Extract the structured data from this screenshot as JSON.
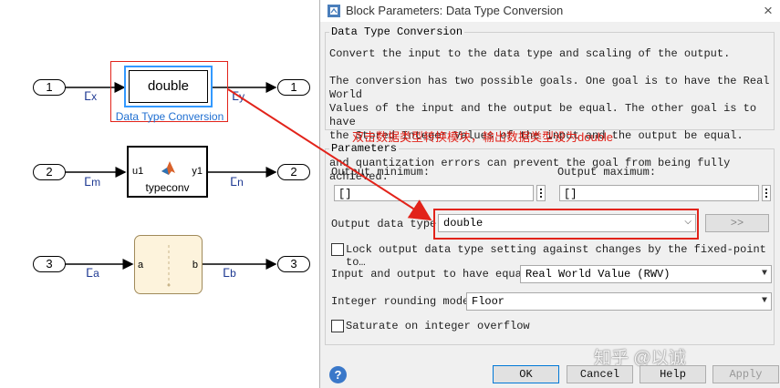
{
  "model": {
    "row1": {
      "in_port": "1",
      "in_signal": "x",
      "block_text": "double",
      "block_name": "Data Type Conversion",
      "out_signal": "y",
      "out_port": "1"
    },
    "row2": {
      "in_port": "2",
      "in_signal": "m",
      "in_label": "u1",
      "out_label": "y1",
      "block_name": "typeconv",
      "out_signal": "n",
      "out_port": "2"
    },
    "row3": {
      "in_port": "3",
      "in_signal": "a",
      "in_label": "a",
      "out_label": "b",
      "out_signal": "b",
      "out_port": "3"
    }
  },
  "dialog": {
    "title": "Block Parameters: Data Type Conversion",
    "close_glyph": "×",
    "section_title": "Data Type Conversion",
    "desc_line1": "Convert the input to the data type and scaling of the output.",
    "desc_para": [
      "The conversion has two possible goals. One goal is to have the Real World",
      "Values of the input and the output be equal.  The other goal is to have",
      "the Stored Integer Values of the input and the output be equal.  Overflows",
      "and quantization errors can prevent the goal from being fully achieved."
    ],
    "annotation": "双击数据类型转换模块，输出数据类型设为double",
    "params_label": "Parameters",
    "out_min_label": "Output minimum:",
    "out_min_value": "[]",
    "out_max_label": "Output maximum:",
    "out_max_value": "[]",
    "out_type_label": "Output data type:",
    "out_type_value": "double",
    "assist_button": ">>",
    "lock_label": "Lock output data type setting against changes by the fixed-point to…",
    "io_equal_label": "Input and output to have equal:",
    "io_equal_value": "Real World Value (RWV)",
    "rounding_label": "Integer rounding mode:",
    "rounding_value": "Floor",
    "saturate_label": "Saturate on integer overflow",
    "watermark": "知乎 @以诚"
  },
  "buttons": {
    "help_icon": "?",
    "ok": "OK",
    "cancel": "Cancel",
    "help": "Help",
    "apply": "Apply"
  },
  "colors": {
    "highlight_red": "#e2231a",
    "selection_blue": "#3399ff",
    "signal_blue": "#1f3a93",
    "annotation_red": "#e2231a"
  }
}
